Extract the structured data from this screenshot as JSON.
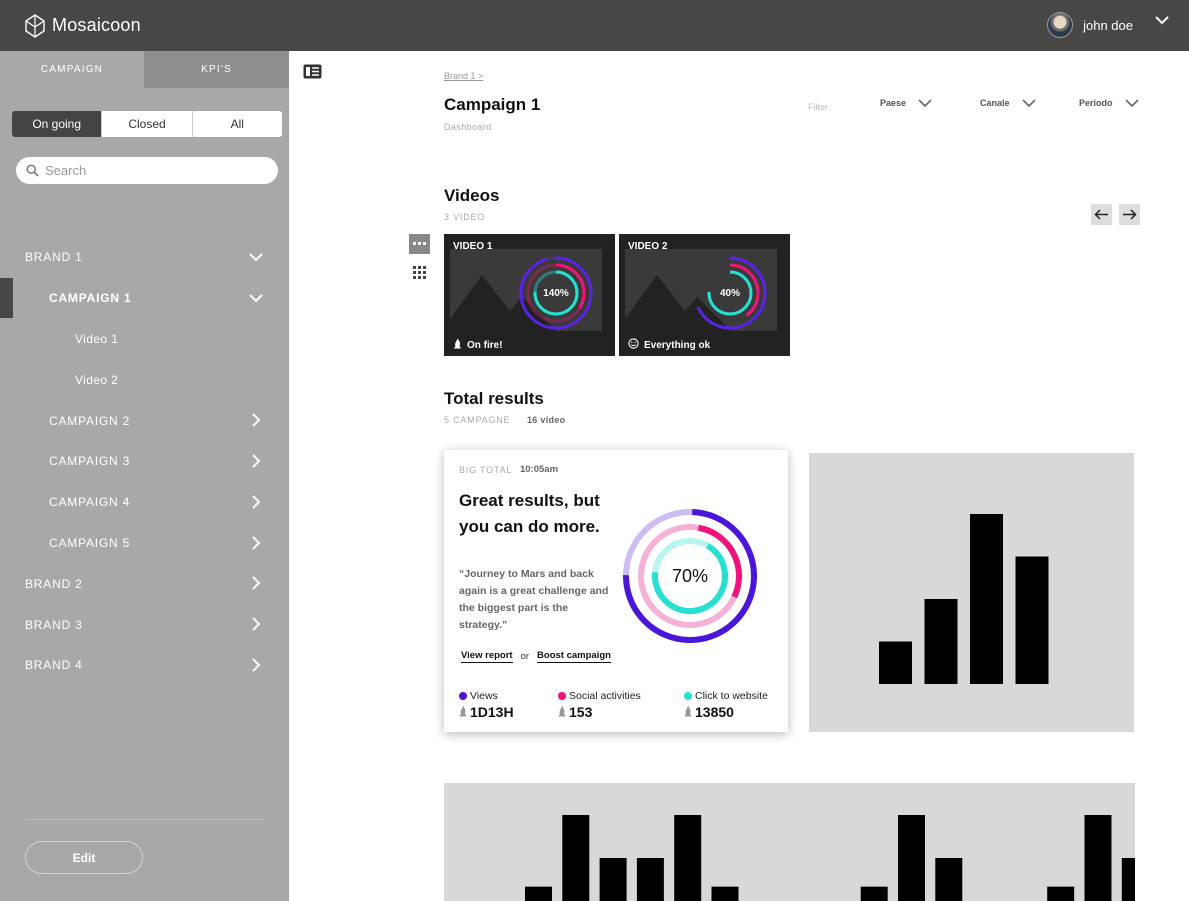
{
  "app": {
    "name": "Mosaicoon"
  },
  "user": {
    "name": "john doe"
  },
  "sidebar": {
    "tabs": [
      "CAMPAIGN",
      "KPI'S"
    ],
    "status_filter": [
      "On going",
      "Closed",
      "All"
    ],
    "search_placeholder": "Search",
    "items": [
      {
        "label": "BRAND 1",
        "level": 0,
        "state": "open"
      },
      {
        "label": "CAMPAIGN 1",
        "level": 1,
        "state": "open",
        "selected": true
      },
      {
        "label": "Video 1",
        "level": 2
      },
      {
        "label": "Video 2",
        "level": 2
      },
      {
        "label": "CAMPAIGN 2",
        "level": 1,
        "state": "closed"
      },
      {
        "label": "CAMPAIGN 3",
        "level": 1,
        "state": "closed"
      },
      {
        "label": "CAMPAIGN 4",
        "level": 1,
        "state": "closed"
      },
      {
        "label": "CAMPAIGN 5",
        "level": 1,
        "state": "closed"
      },
      {
        "label": "BRAND 2",
        "level": 0,
        "state": "closed"
      },
      {
        "label": "BRAND 3",
        "level": 0,
        "state": "closed"
      },
      {
        "label": "BRAND 4",
        "level": 0,
        "state": "closed"
      }
    ],
    "edit_label": "Edit"
  },
  "header": {
    "breadcrumb": "Brand 1 >",
    "title": "Campaign 1",
    "subtitle": "Dashboard",
    "filter_label": "Filter",
    "filters": [
      "Paese",
      "Canale",
      "Periodo"
    ]
  },
  "videos": {
    "title": "Videos",
    "count_label": "3 VIDEO",
    "items": [
      {
        "title": "VIDEO 1",
        "percent": "140%",
        "status": "On fire!",
        "status_icon": "fire-icon"
      },
      {
        "title": "VIDEO 2",
        "percent": "40%",
        "status": "Everything ok",
        "status_icon": "smiley-icon"
      }
    ]
  },
  "totals": {
    "title": "Total results",
    "campaigns_label": "5 CAMPAGNE",
    "videos_label": "16 video",
    "card": {
      "label": "BIG TOTAL",
      "time": "10:05am",
      "headline": "Great results, but you can do more.",
      "quote": "“Journey to Mars and back again is a great challenge and the biggest part is the strategy.”",
      "link_report": "View report",
      "link_or": "or",
      "link_boost": "Boost campaign",
      "percent": "70%",
      "metrics": [
        {
          "label": "Views",
          "value": "1D13H",
          "color": "#4a16d8"
        },
        {
          "label": "Social activities",
          "value": "153",
          "color": "#f0147a"
        },
        {
          "label": "Click to website",
          "value": "13850",
          "color": "#26e0d2"
        }
      ]
    }
  },
  "chart_data": [
    {
      "type": "bar",
      "values": [
        2,
        4,
        8,
        6
      ]
    },
    {
      "type": "bar",
      "values": [
        1,
        6,
        3,
        3,
        6,
        1,
        0,
        0,
        0,
        1,
        6,
        3,
        0,
        0,
        1,
        6,
        3
      ]
    }
  ],
  "colors": {
    "topbar": "#474747",
    "sidebar": "#a8a8a8",
    "violet": "#4a16d8",
    "pink": "#f0147a",
    "cyan": "#26e0d2"
  }
}
